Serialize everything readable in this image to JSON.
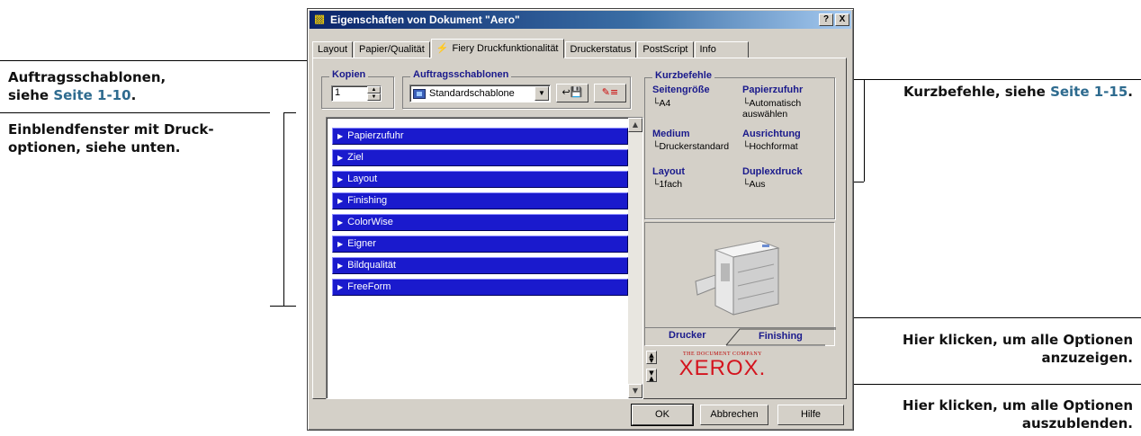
{
  "annotations": {
    "templates_line1": "Auftragsschablonen,",
    "templates_line2_prefix": "siehe ",
    "templates_link": "Seite 1-10",
    "templates_suffix": ".",
    "popup_line1": "Einblendfenster mit Druck-",
    "popup_line2": "optionen, siehe unten.",
    "shortcuts_prefix": "Kurzbefehle, siehe ",
    "shortcuts_link": "Seite 1-15",
    "shortcuts_suffix": ".",
    "show_all_line1": "Hier klicken, um alle Optionen",
    "show_all_line2": "anzuzeigen.",
    "hide_all_line1": "Hier klicken, um alle Optionen",
    "hide_all_line2": "auszublenden."
  },
  "window": {
    "title": "Eigenschaften von Dokument \"Aero\"",
    "help_btn": "?",
    "close_btn": "X"
  },
  "tabs": [
    {
      "label": "Layout"
    },
    {
      "label": "Papier/Qualität"
    },
    {
      "label": "Fiery Druckfunktionalität"
    },
    {
      "label": "Druckerstatus"
    },
    {
      "label": "PostScript"
    },
    {
      "label": "Info"
    }
  ],
  "copies": {
    "label": "Kopien",
    "value": "1"
  },
  "templates": {
    "label": "Auftragsschablonen",
    "selected": "Standardschablone"
  },
  "options": [
    {
      "label": "Papierzufuhr"
    },
    {
      "label": "Ziel"
    },
    {
      "label": "Layout"
    },
    {
      "label": "Finishing"
    },
    {
      "label": "ColorWise"
    },
    {
      "label": "Eigner"
    },
    {
      "label": "Bildqualität"
    },
    {
      "label": "FreeForm"
    }
  ],
  "shortcuts": {
    "label": "Kurzbefehle",
    "items": [
      {
        "title": "Seitengröße",
        "value": "A4"
      },
      {
        "title": "Papierzufuhr",
        "value": "Automatisch auswählen"
      },
      {
        "title": "Medium",
        "value": "Druckerstandard"
      },
      {
        "title": "Ausrichtung",
        "value": "Hochformat"
      },
      {
        "title": "Layout",
        "value": "1fach"
      },
      {
        "title": "Duplexdruck",
        "value": "Aus"
      }
    ]
  },
  "printer_tabs": {
    "printer": "Drucker",
    "finishing": "Finishing"
  },
  "brand": {
    "small": "THE DOCUMENT COMPANY",
    "name": "XEROX."
  },
  "buttons": {
    "ok": "OK",
    "cancel": "Abbrechen",
    "help": "Hilfe"
  }
}
